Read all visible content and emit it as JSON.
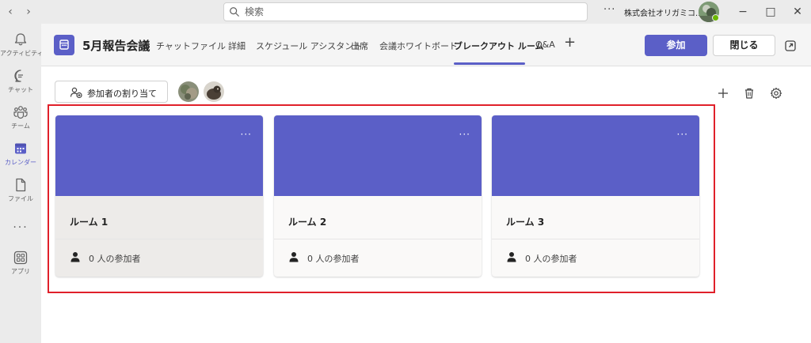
{
  "titlebar": {
    "search_placeholder": "検索",
    "more_label": "···",
    "org_name": "株式会社オリガミコ...",
    "minimize": "−",
    "maximize": "□",
    "close": "✕"
  },
  "rail": {
    "items": [
      {
        "label": "アクティビティ",
        "icon": "bell-icon"
      },
      {
        "label": "チャット",
        "icon": "chat-icon"
      },
      {
        "label": "チーム",
        "icon": "teams-icon"
      },
      {
        "label": "カレンダー",
        "icon": "calendar-icon",
        "active": true
      },
      {
        "label": "ファイル",
        "icon": "file-icon"
      },
      {
        "label": "アプリ",
        "icon": "apps-icon"
      }
    ],
    "more_label": "···"
  },
  "header": {
    "title": "5月報告会議",
    "tabs": [
      {
        "label": "チャット"
      },
      {
        "label": "ファイル"
      },
      {
        "label": "詳細"
      },
      {
        "label": "スケジュール アシスタント"
      },
      {
        "label": "出席"
      },
      {
        "label": "会議ホワイトボード"
      },
      {
        "label": "ブレークアウト ルーム",
        "active": true
      },
      {
        "label": "Q&A"
      }
    ],
    "add_tab": "+",
    "join_label": "参加",
    "close_label": "閉じる"
  },
  "toolbar": {
    "assign_label": "参加者の割り当て"
  },
  "rooms": [
    {
      "name": "ルーム 1",
      "participants": "0 人の参加者",
      "more": "···"
    },
    {
      "name": "ルーム 2",
      "participants": "0 人の参加者",
      "more": "···"
    },
    {
      "name": "ルーム 3",
      "participants": "0 人の参加者",
      "more": "···"
    }
  ],
  "colors": {
    "accent": "#5b5fc7",
    "highlight": "#e0202a",
    "presence": "#6bb700"
  }
}
